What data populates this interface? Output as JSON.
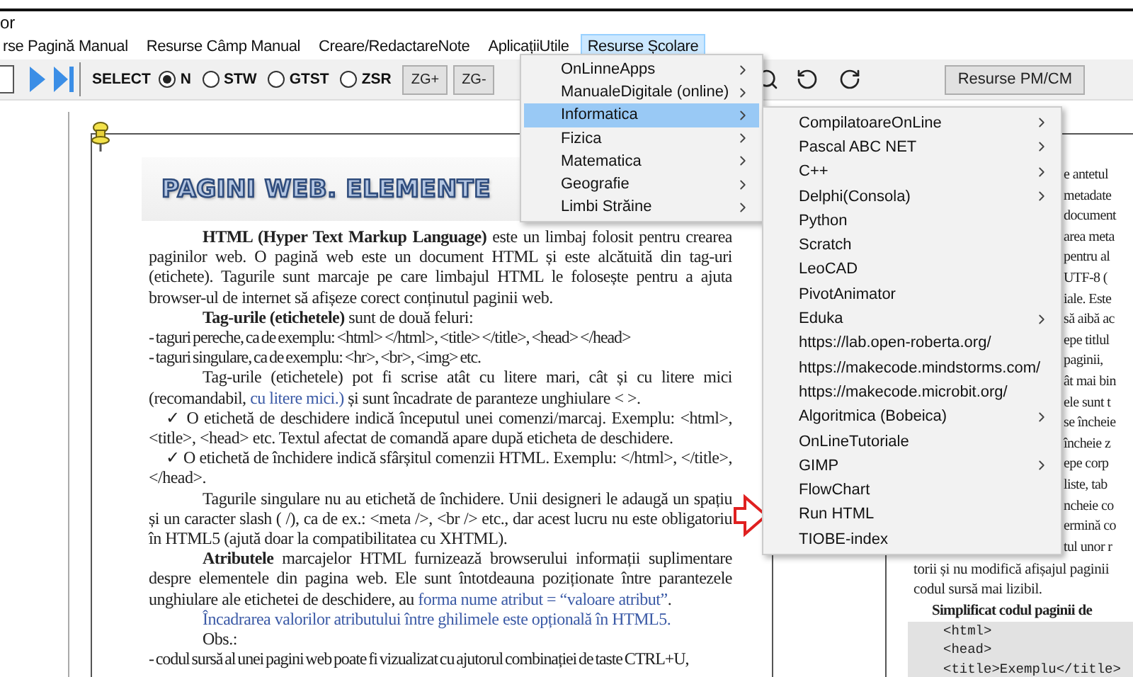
{
  "window": {
    "title": "or"
  },
  "menubar": [
    {
      "label": "rse Pagină Manual",
      "selected": false
    },
    {
      "label": "Resurse Câmp Manual",
      "selected": false
    },
    {
      "label": "Creare/RedactareNote",
      "selected": false
    },
    {
      "label": "AplicațiiUtile",
      "selected": false
    },
    {
      "label": "Resurse Școlare",
      "selected": true
    }
  ],
  "toolbar": {
    "select_label": "SELECT",
    "modes": [
      {
        "label": "N",
        "selected": true
      },
      {
        "label": "STW",
        "selected": false
      },
      {
        "label": "GTST",
        "selected": false
      },
      {
        "label": "ZSR",
        "selected": false
      }
    ],
    "buttons": [
      "ZG+",
      "ZG-"
    ],
    "right_button": "Resurse PM/CM"
  },
  "left_page": {
    "title": "PAGINI WEB. ELEMENTE",
    "paragraphs": [
      {
        "kind": "indent",
        "segments": [
          {
            "kind": "bold",
            "text": "HTML (Hyper Text Markup Language)"
          },
          {
            "kind": "plain",
            "text": " este un limbaj folosit pentru crearea paginilor web. O pagină web este un document HTML și este alcătuită din tag-uri (etichete). Tagurile sunt marcaje pe care limbajul HTML le folosește pentru a ajuta browser-ul de internet să afișeze corect conținutul paginii web."
          }
        ]
      },
      {
        "kind": "indent",
        "segments": [
          {
            "kind": "bold",
            "text": "Tag-urile (etichetele)"
          },
          {
            "kind": "plain",
            "text": " sunt de două feluri:"
          }
        ]
      },
      {
        "kind": "plain",
        "segments": [
          {
            "kind": "plain",
            "text": "- taguri pereche, ca de exemplu: <html> </html>, <title> </title>, <head> </head>"
          }
        ]
      },
      {
        "kind": "plain",
        "segments": [
          {
            "kind": "plain",
            "text": "- taguri singulare, ca de exemplu: <hr>, <br>, <img> etc."
          }
        ]
      },
      {
        "kind": "indent",
        "segments": [
          {
            "kind": "plain",
            "text": "Tag-urile (etichetele) pot fi scrise atât cu litere mari, cât și cu litere mici (recomandabil, "
          },
          {
            "kind": "link",
            "text": "cu litere mici.)"
          },
          {
            "kind": "plain",
            "text": " și sunt încadrate de paranteze unghiulare < >."
          }
        ]
      },
      {
        "kind": "check",
        "segments": [
          {
            "kind": "plain",
            "text": "✓ O etichetă de deschidere indică începutul unei comenzi/marcaj. Exemplu: <html>, <title>, <head> etc. Textul afectat de comandă apare după eticheta de deschidere."
          }
        ]
      },
      {
        "kind": "check",
        "segments": [
          {
            "kind": "plain",
            "text": "✓ O etichetă de închidere indică sfârșitul comenzii HTML. Exemplu: </html>, </title>, </head>."
          }
        ]
      },
      {
        "kind": "indent",
        "segments": [
          {
            "kind": "plain",
            "text": "Tagurile singulare nu au etichetă de închidere. Unii designeri le adaugă un spațiu și un caracter slash ( /), ca de ex.: <meta />, <br /> etc., dar acest lucru nu este obligatoriu în HTML5 (ajută doar la compatibilitatea cu XHTML)."
          }
        ]
      },
      {
        "kind": "indent",
        "segments": [
          {
            "kind": "bold",
            "text": "Atributele"
          },
          {
            "kind": "plain",
            "text": " marcajelor HTML furnizează browserului informații suplimentare despre elementele din pagina web. Ele sunt întotdeauna poziționate între parantezele unghiulare ale etichetei de deschidere, au "
          },
          {
            "kind": "link",
            "text": "forma nume atribut = “valoare atribut”"
          },
          {
            "kind": "plain",
            "text": "."
          }
        ]
      },
      {
        "kind": "indent",
        "segments": [
          {
            "kind": "link",
            "text": "Încadrarea valorilor atributului între ghilimele este opțională în HTML5."
          }
        ]
      },
      {
        "kind": "indent",
        "segments": [
          {
            "kind": "plain",
            "text": "Obs.:"
          }
        ]
      },
      {
        "kind": "plain",
        "segments": [
          {
            "kind": "plain",
            "text": "- codul sursă al unei pagini web poate fi vizualizat cu ajutorul combinației de taste CTRL+U,"
          }
        ]
      }
    ]
  },
  "right_page": {
    "fragments": [
      "e antetul",
      "metadate",
      "document",
      "area meta",
      "pentru al",
      "UTF-8 (",
      "iale. Este",
      "să aibă ac",
      "epe titlul",
      "paginii,",
      "ât mai bin",
      "ele sunt t",
      "se încheie",
      "încheie z",
      "epe corp",
      "liste, tab",
      "ncheie co",
      "ermină co",
      "tul unor r"
    ],
    "lines": [
      "torii și nu modifică afișajul paginii",
      "codul sursă mai lizibil."
    ],
    "subheading": "Simplificat codul paginii de",
    "code": [
      "<html>",
      "<head>",
      "<title>Exemplu</title>"
    ]
  },
  "menus": [
    {
      "items": [
        {
          "label": "OnLinneApps",
          "has_submenu": true,
          "selected": false
        },
        {
          "label": "ManualeDigitale (online)",
          "has_submenu": true,
          "selected": false
        },
        {
          "label": "Informatica",
          "has_submenu": true,
          "selected": true
        },
        {
          "label": "Fizica",
          "has_submenu": true,
          "selected": false
        },
        {
          "label": "Matematica",
          "has_submenu": true,
          "selected": false
        },
        {
          "label": "Geografie",
          "has_submenu": true,
          "selected": false
        },
        {
          "label": "Limbi Străine",
          "has_submenu": true,
          "selected": false
        }
      ]
    },
    {
      "items": [
        {
          "label": "CompilatoareOnLine",
          "has_submenu": true,
          "selected": false
        },
        {
          "label": "Pascal ABC NET",
          "has_submenu": true,
          "selected": false
        },
        {
          "label": "C++",
          "has_submenu": true,
          "selected": false
        },
        {
          "label": "Delphi(Consola)",
          "has_submenu": true,
          "selected": false
        },
        {
          "label": "Python",
          "has_submenu": false,
          "selected": false
        },
        {
          "label": "Scratch",
          "has_submenu": false,
          "selected": false
        },
        {
          "label": "LeoCAD",
          "has_submenu": false,
          "selected": false
        },
        {
          "label": "PivotAnimator",
          "has_submenu": false,
          "selected": false
        },
        {
          "label": "Eduka",
          "has_submenu": true,
          "selected": false
        },
        {
          "label": "https://lab.open-roberta.org/",
          "has_submenu": false,
          "selected": false
        },
        {
          "label": "https://makecode.mindstorms.com/",
          "has_submenu": false,
          "selected": false
        },
        {
          "label": "https://makecode.microbit.org/",
          "has_submenu": false,
          "selected": false
        },
        {
          "label": "Algoritmica (Bobeica)",
          "has_submenu": true,
          "selected": false
        },
        {
          "label": "OnLineTutoriale",
          "has_submenu": false,
          "selected": false
        },
        {
          "label": "GIMP",
          "has_submenu": true,
          "selected": false
        },
        {
          "label": "FlowChart",
          "has_submenu": false,
          "selected": false
        },
        {
          "label": "Run HTML",
          "has_submenu": false,
          "selected": false
        },
        {
          "label": "TIOBE-index",
          "has_submenu": false,
          "selected": false
        }
      ]
    }
  ]
}
